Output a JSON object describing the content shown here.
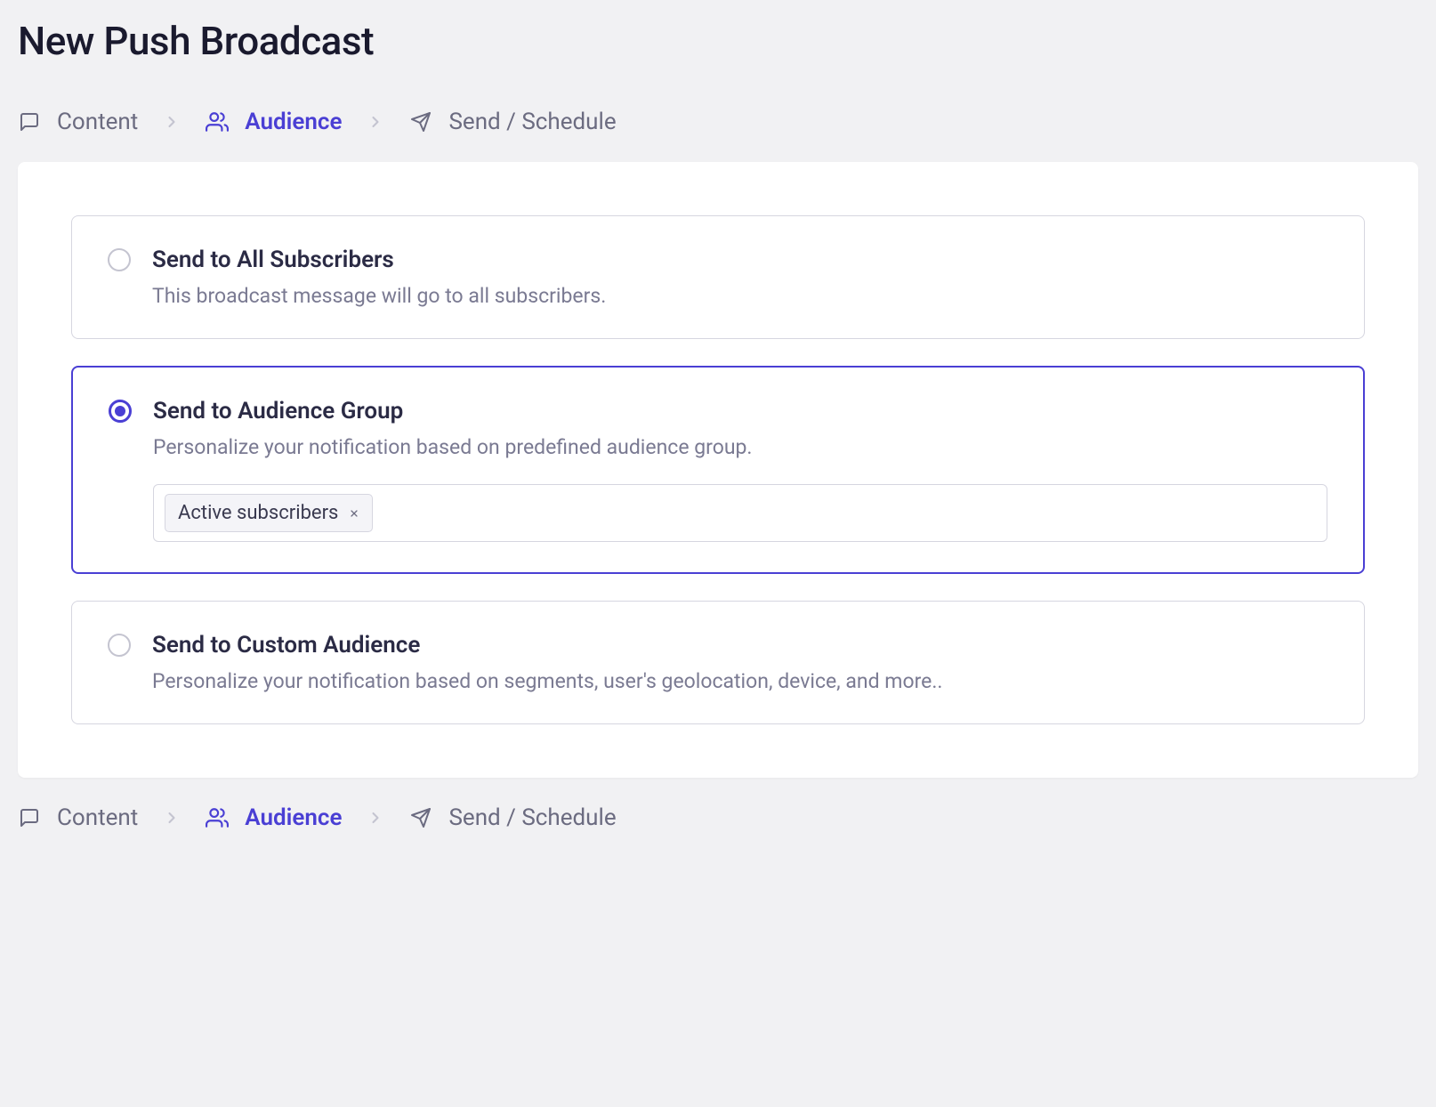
{
  "page": {
    "title": "New Push Broadcast"
  },
  "stepper": {
    "steps": [
      {
        "label": "Content",
        "icon": "message"
      },
      {
        "label": "Audience",
        "icon": "audience"
      },
      {
        "label": "Send / Schedule",
        "icon": "send"
      }
    ],
    "active_index": 1
  },
  "options": {
    "all": {
      "title": "Send to All Subscribers",
      "desc": "This broadcast message will go to all subscribers."
    },
    "group": {
      "title": "Send to Audience Group",
      "desc": "Personalize your notification based on predefined audience group.",
      "tags": [
        {
          "label": "Active subscribers"
        }
      ]
    },
    "custom": {
      "title": "Send to Custom Audience",
      "desc": "Personalize your notification based on segments, user's geolocation, device, and more.."
    }
  }
}
